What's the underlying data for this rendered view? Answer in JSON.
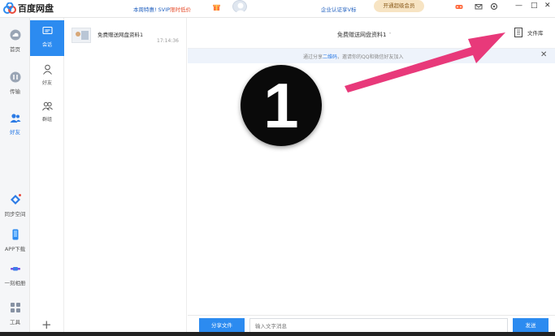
{
  "app": {
    "title": "百度网盘"
  },
  "titlebar": {
    "promo_prefix": "本周特惠! SVIP",
    "promo_highlight": "限时低价",
    "cert": "企业认证享V标",
    "vip_button": "开通超级会员",
    "icons": [
      "gift-icon",
      "user-avatar",
      "game-icon",
      "mail-icon",
      "settings-icon",
      "minimize-icon",
      "maximize-icon",
      "close-icon"
    ],
    "minimize": "—",
    "maximize": "□",
    "close": "✕"
  },
  "leftnav": {
    "items": [
      {
        "label": "首页",
        "icon": "cloud-icon"
      },
      {
        "label": "传输",
        "icon": "transfer-icon"
      },
      {
        "label": "好友",
        "icon": "friends-icon"
      },
      {
        "label": "同步空间",
        "icon": "sync-icon"
      },
      {
        "label": "APP下载",
        "icon": "phone-icon"
      },
      {
        "label": "一刻相册",
        "icon": "album-icon"
      },
      {
        "label": "工具",
        "icon": "tools-icon"
      }
    ],
    "active": "好友"
  },
  "tabs": {
    "items": [
      {
        "label": "会话",
        "icon": "chat-icon"
      },
      {
        "label": "好友",
        "icon": "friend-icon"
      },
      {
        "label": "群组",
        "icon": "group-icon"
      }
    ],
    "active": "会话",
    "add": "+"
  },
  "conversations": [
    {
      "name": "免费赠送网盘资料1",
      "time": "17:14:36"
    }
  ],
  "chat": {
    "title": "免费赠送网盘资料1",
    "chevron": "˅",
    "file_library": "文件库",
    "notice_prefix": "通过分享",
    "notice_link": "二维码",
    "notice_suffix": "，邀请你的QQ和微信好友加入",
    "notice_close": "✕",
    "annotation_number": "1"
  },
  "bottombar": {
    "share_file": "分享文件",
    "input_placeholder": "输入文字消息",
    "send": "发送"
  },
  "colors": {
    "accent": "#2c8bf0",
    "arrow": "#e8397a",
    "vip": "#f7e4c3"
  }
}
